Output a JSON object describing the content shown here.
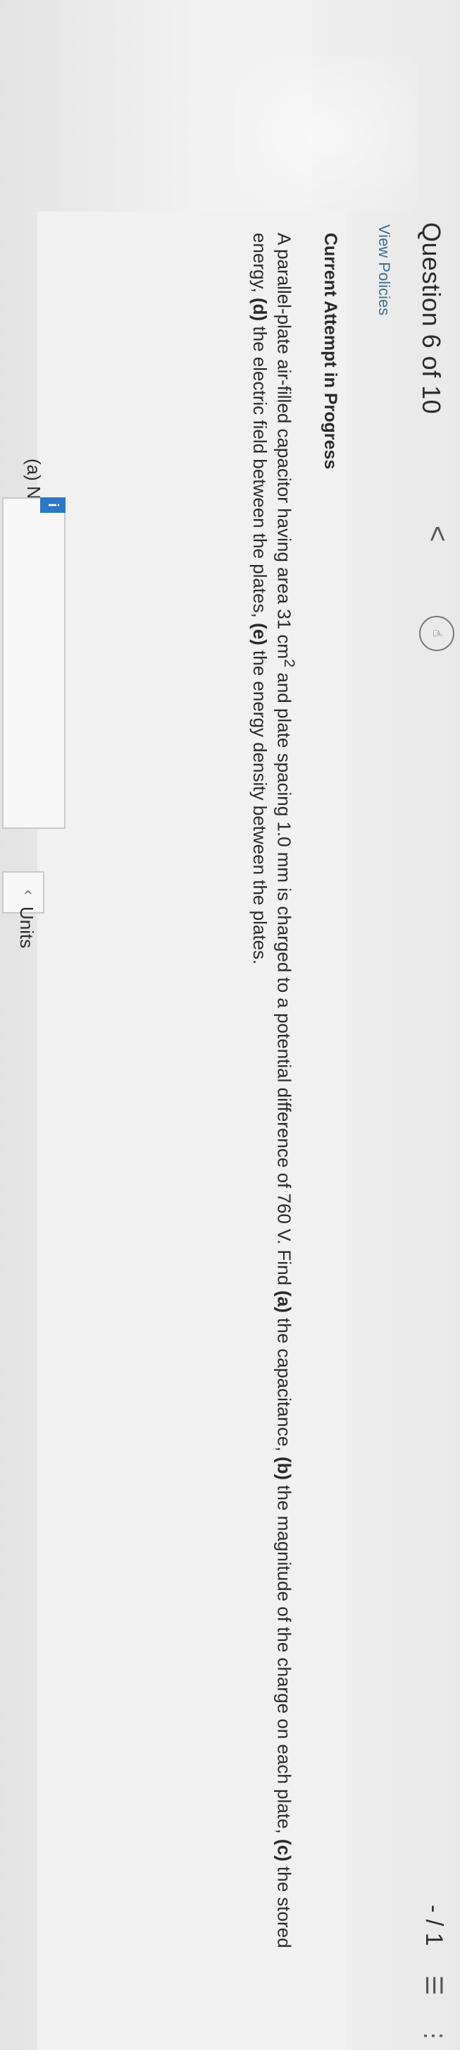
{
  "header": {
    "title": "Question 6 of 10",
    "prev_icon": "<",
    "hint_icon_name": "hand-pointer-icon",
    "score": "- / 1",
    "list_icon": "☰",
    "more_icon": "⋮"
  },
  "policies_link": "View Policies",
  "attempt_heading": "Current Attempt in Progress",
  "question": {
    "intro": "A parallel-plate air-filled capacitor having area 31 cm",
    "sup": "2",
    "mid": " and plate spacing 1.0 mm is charged to a potential difference of 760 V. Find ",
    "a_lbl": "(a)",
    "a_txt": " the capacitance, ",
    "b_lbl": "(b)",
    "b_txt": " the magnitude of the charge on each plate, ",
    "c_lbl": "(c)",
    "c_txt": " the stored energy, ",
    "d_lbl": "(d)",
    "d_txt": " the electric field between the plates, ",
    "e_lbl": "(e)",
    "e_txt": " the energy density between the plates."
  },
  "answer": {
    "part_label": "(a)  Number",
    "info_badge": "i",
    "units_label": "Units",
    "units_chevron": "‹"
  },
  "colors": {
    "link": "#3f6f8f",
    "info_badge": "#2b78c6"
  }
}
